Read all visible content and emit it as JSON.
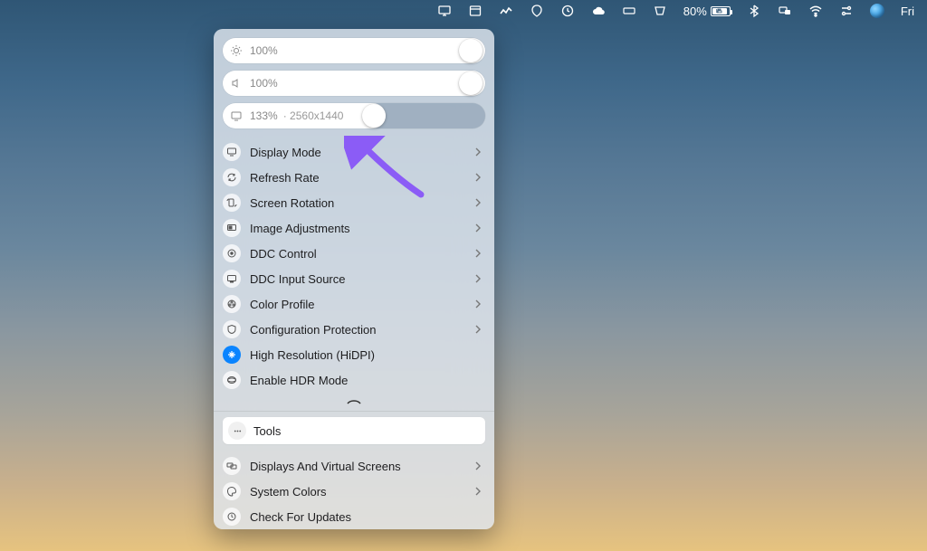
{
  "menubar": {
    "battery_percent": "80%",
    "date": "Fri"
  },
  "panel": {
    "sliders": {
      "brightness": {
        "value": "100%"
      },
      "volume": {
        "value": "100%"
      },
      "scale": {
        "value": "133%",
        "resolution": "2560x1440"
      }
    },
    "items": [
      {
        "label": "Display Mode",
        "submenu": true
      },
      {
        "label": "Refresh Rate",
        "submenu": true
      },
      {
        "label": "Screen Rotation",
        "submenu": true
      },
      {
        "label": "Image Adjustments",
        "submenu": true
      },
      {
        "label": "DDC Control",
        "submenu": true
      },
      {
        "label": "DDC Input Source",
        "submenu": true
      },
      {
        "label": "Color Profile",
        "submenu": true
      },
      {
        "label": "Configuration Protection",
        "submenu": true
      },
      {
        "label": "High Resolution (HiDPI)",
        "submenu": false
      },
      {
        "label": "Enable HDR Mode",
        "submenu": false
      }
    ],
    "tools_header": "Tools",
    "tools_items": [
      {
        "label": "Displays And Virtual Screens",
        "submenu": true
      },
      {
        "label": "System Colors",
        "submenu": true
      },
      {
        "label": "Check For Updates",
        "submenu": false
      }
    ]
  },
  "colors": {
    "accent": "#0a84ff",
    "arrow": "#8b5cf6"
  }
}
